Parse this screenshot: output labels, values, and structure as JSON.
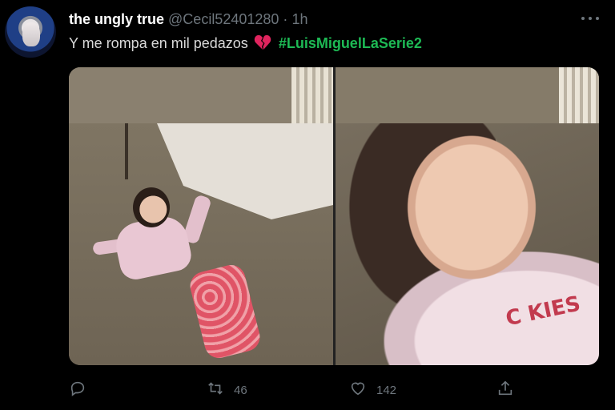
{
  "tweet": {
    "display_name": "the ungly true",
    "handle": "@Cecil52401280",
    "separator": "·",
    "time": "1h",
    "text": "Y me rompa en mil pedazos",
    "emoji": "broken-heart",
    "hashtag": "#LuisMiguelLaSerie2"
  },
  "media": {
    "count": 2,
    "right_shirt_text": "C  KIES"
  },
  "actions": {
    "reply_count": "",
    "retweet_count": "46",
    "like_count": "142",
    "icons": [
      "reply-icon",
      "retweet-icon",
      "like-icon",
      "share-icon"
    ]
  },
  "colors": {
    "background": "#000000",
    "hashtag": "#1db954",
    "muted": "#6e767d",
    "text": "#d9d9d9",
    "broken_heart": "#e0245e"
  }
}
